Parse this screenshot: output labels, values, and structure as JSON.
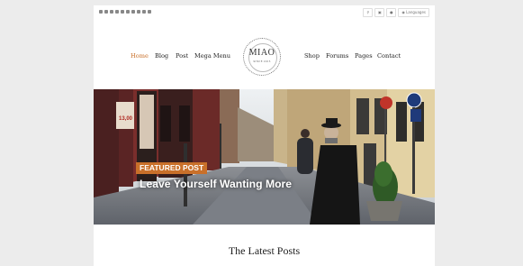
{
  "topbar": {
    "social_icons": [
      "facebook-icon",
      "twitter-icon",
      "vine-icon",
      "instagram-icon",
      "tumblr-icon",
      "flickr-icon",
      "behance-icon",
      "vimeo-icon",
      "dribbble-icon",
      "github-icon"
    ],
    "language_label": "Languages"
  },
  "nav": {
    "left": [
      "Home",
      "Blog",
      "Post",
      "Mega Menu"
    ],
    "right": [
      "Shop",
      "Forums",
      "Pages",
      "Contact"
    ],
    "active_color": "#c9702a"
  },
  "logo": {
    "name": "MIAO",
    "since": "SINCE 2015"
  },
  "hero": {
    "badge": "FEATURED POST",
    "title": "Leave Yourself Wanting More",
    "sign_text": "13,00",
    "badge_color": "#c9702a"
  },
  "section": {
    "title": "The Latest Posts"
  }
}
